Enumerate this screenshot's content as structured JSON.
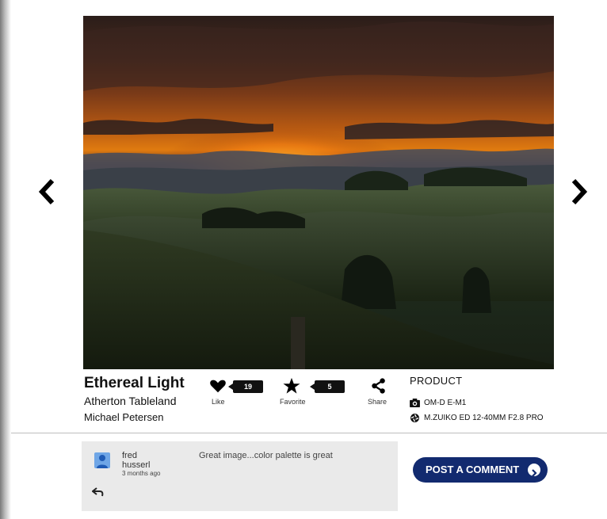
{
  "photo": {
    "title": "Ethereal Light",
    "location": "Atherton Tableland",
    "author": "Michael Petersen"
  },
  "navigation": {
    "prev_icon": "chevron-left-icon",
    "next_icon": "chevron-right-icon"
  },
  "actions": {
    "like": {
      "label": "Like",
      "count": "19",
      "icon": "heart-icon"
    },
    "favorite": {
      "label": "Favorite",
      "count": "5",
      "icon": "star-icon"
    },
    "share": {
      "label": "Share",
      "icon": "share-icon"
    }
  },
  "product": {
    "heading": "PRODUCT",
    "camera": "OM-D E-M1",
    "lens": "M.ZUIKO ED 12-40MM F2.8 PRO"
  },
  "comments": [
    {
      "user_first": "fred",
      "user_last": "husserl",
      "time": "3 months ago",
      "text": "Great image...color palette is great"
    }
  ],
  "post_comment": {
    "label": "POST A COMMENT"
  },
  "colors": {
    "button_bg": "#122a6f",
    "comment_bg": "#eaeaea",
    "avatar": "#6fa6e6"
  }
}
